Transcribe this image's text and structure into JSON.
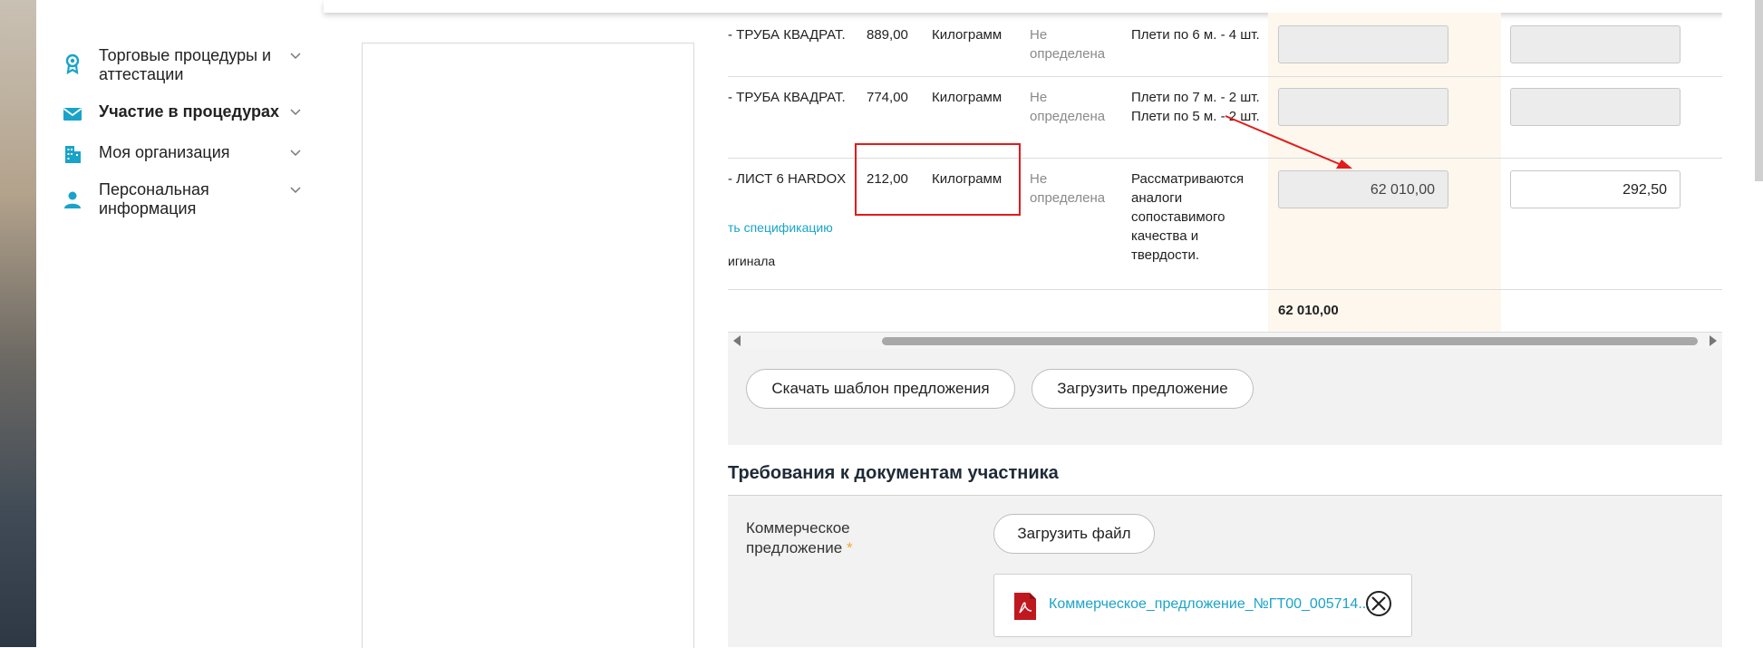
{
  "sidebar": {
    "items": [
      {
        "label": "Торговые процедуры и аттестации",
        "icon": "award-icon",
        "bold": false
      },
      {
        "label": "Участие в процедурах",
        "icon": "mail-icon",
        "bold": true
      },
      {
        "label": "Моя организация",
        "icon": "building-icon",
        "bold": false
      },
      {
        "label": "Персональная информация",
        "icon": "user-icon",
        "bold": false
      }
    ]
  },
  "table": {
    "rows": [
      {
        "name": "- ТРУБА КВАДРАТ.",
        "qty": "889,00",
        "unit": "Килограмм",
        "delivery": "Не определена",
        "note": "Плети по 6 м. - 4 шт.",
        "price": "",
        "total": ""
      },
      {
        "name": "- ТРУБА КВАДРАТ.",
        "qty": "774,00",
        "unit": "Килограмм",
        "delivery": "Не определена",
        "note": "Плети по 7 м. - 2 шт. Плети по 5 м. - 2 шт.",
        "price": "",
        "total": ""
      },
      {
        "name": "- ЛИСТ 6 HARDOX",
        "qty": "212,00",
        "unit": "Килограмм",
        "delivery": "Не определена",
        "note": "Рассматриваются аналоги сопоставимого качества и твердости.",
        "price": "62 010,00",
        "total": "292,50",
        "link": "ть спецификацию",
        "extra": "игинала"
      }
    ],
    "grand_total": "62 010,00"
  },
  "buttons": {
    "download_template": "Скачать шаблон предложения",
    "upload_offer": "Загрузить предложение"
  },
  "requirements": {
    "title": "Требования к документам участника",
    "label": "Коммерческое предложение",
    "required_mark": "*",
    "upload_file": "Загрузить файл",
    "file_name": "Коммерческое_предложение_№ГТ00_005714..."
  },
  "colors": {
    "accent": "#1aa3c9",
    "annotation": "#e21b1b",
    "highlight_column": "#fdf7ee",
    "pdf_icon": "#c0181f"
  }
}
